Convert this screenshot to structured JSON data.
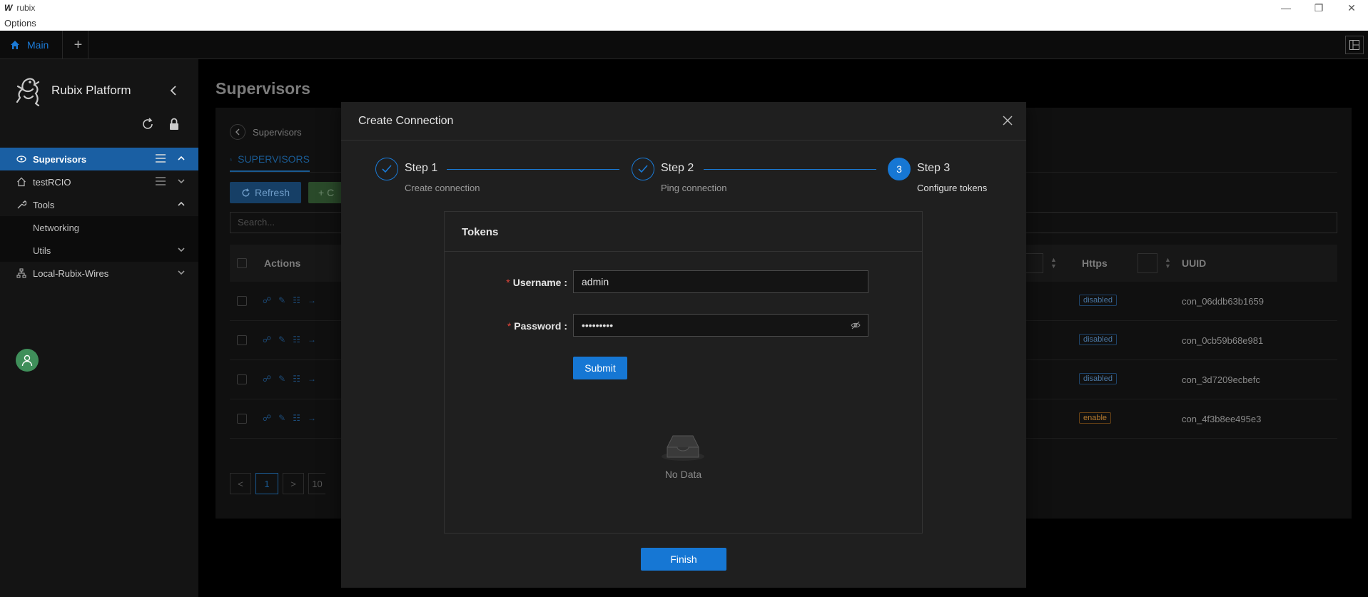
{
  "window": {
    "app_name": "rubix",
    "logo_letter": "W",
    "menu": "Options",
    "controls": [
      "—",
      "❐",
      "✕"
    ]
  },
  "tabs": {
    "main_label": "Main",
    "add_label": "+"
  },
  "sidebar": {
    "brand": "Rubix Platform",
    "items": [
      {
        "label": "Supervisors",
        "icon": "cloud-icon",
        "active": true
      },
      {
        "label": "testRCIO",
        "icon": "home-icon"
      },
      {
        "label": "Tools",
        "icon": "wrench-icon",
        "expanded": true
      },
      {
        "label": "Networking"
      },
      {
        "label": "Utils"
      },
      {
        "label": "Local-Rubix-Wires",
        "icon": "hierarchy-icon"
      }
    ]
  },
  "main": {
    "page_title": "Supervisors",
    "breadcrumb": "Supervisors",
    "tab_label": "SUPERVISORS",
    "refresh_label": "Refresh",
    "create_label": "C",
    "search_placeholder": "Search...",
    "columns": {
      "actions": "Actions",
      "https": "Https",
      "uuid": "UUID"
    },
    "rows": [
      {
        "https": "disabled",
        "uuid": "con_06ddb63b1659"
      },
      {
        "https": "disabled",
        "uuid": "con_0cb59b68e981"
      },
      {
        "https": "disabled",
        "uuid": "con_3d7209ecbefc"
      },
      {
        "https": "enable",
        "uuid": "con_4f3b8ee495e3"
      }
    ],
    "pagination": {
      "prev": "<",
      "page": "1",
      "next": ">",
      "size": "10"
    }
  },
  "modal": {
    "title": "Create Connection",
    "steps": [
      {
        "number": "1",
        "title": "Step 1",
        "description": "Create connection",
        "status": "finished"
      },
      {
        "number": "2",
        "title": "Step 2",
        "description": "Ping connection",
        "status": "finished"
      },
      {
        "number": "3",
        "title": "Step 3",
        "description": "Configure tokens",
        "status": "current"
      }
    ],
    "tokens": {
      "title": "Tokens",
      "username_label": "Username",
      "username_value": "admin",
      "password_label": "Password",
      "password_value": "•••••••••",
      "submit_label": "Submit",
      "empty_text": "No Data"
    },
    "finish_label": "Finish"
  },
  "colors": {
    "accent": "#1677d4",
    "active_nav": "#1a5fa3",
    "required": "#e0453a"
  }
}
